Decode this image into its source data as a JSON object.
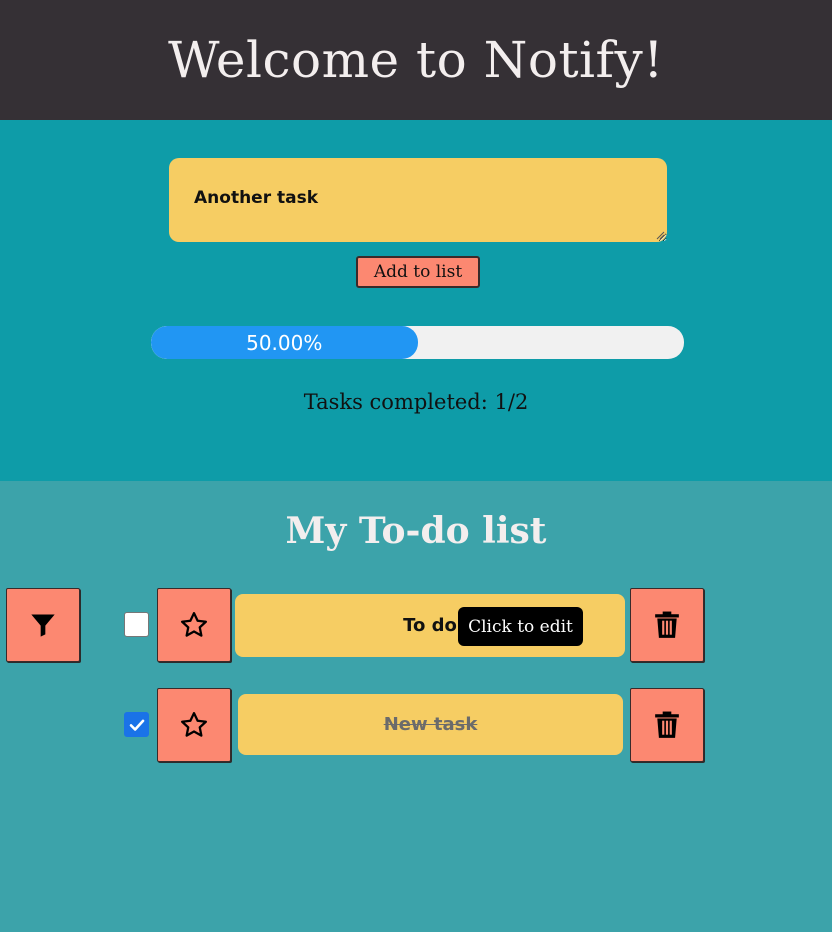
{
  "header": {
    "title": "Welcome to Notify!"
  },
  "composer": {
    "input_value": "Another task",
    "add_button_label": "Add to list"
  },
  "progress": {
    "percent": 50,
    "label": "50.00%",
    "tasks_completed_text": "Tasks completed: 1/2"
  },
  "list": {
    "title": "My To-do list",
    "items": [
      {
        "label": "To do",
        "done": false,
        "starred": false
      },
      {
        "label": "New task",
        "done": true,
        "starred": false
      }
    ]
  },
  "tooltip": {
    "text": "Click to edit"
  },
  "icons": {
    "filter": "filter-icon",
    "star": "star-icon",
    "trash": "trash-icon",
    "check": "checkmark-icon"
  },
  "colors": {
    "header_bg": "#353035",
    "top_bg": "#0e9ca8",
    "list_bg": "#3ca3aa",
    "accent_yellow": "#f6cd63",
    "accent_salmon": "#fc8871",
    "progress_fill": "#2196f3",
    "progress_track": "#f1f1f1"
  }
}
